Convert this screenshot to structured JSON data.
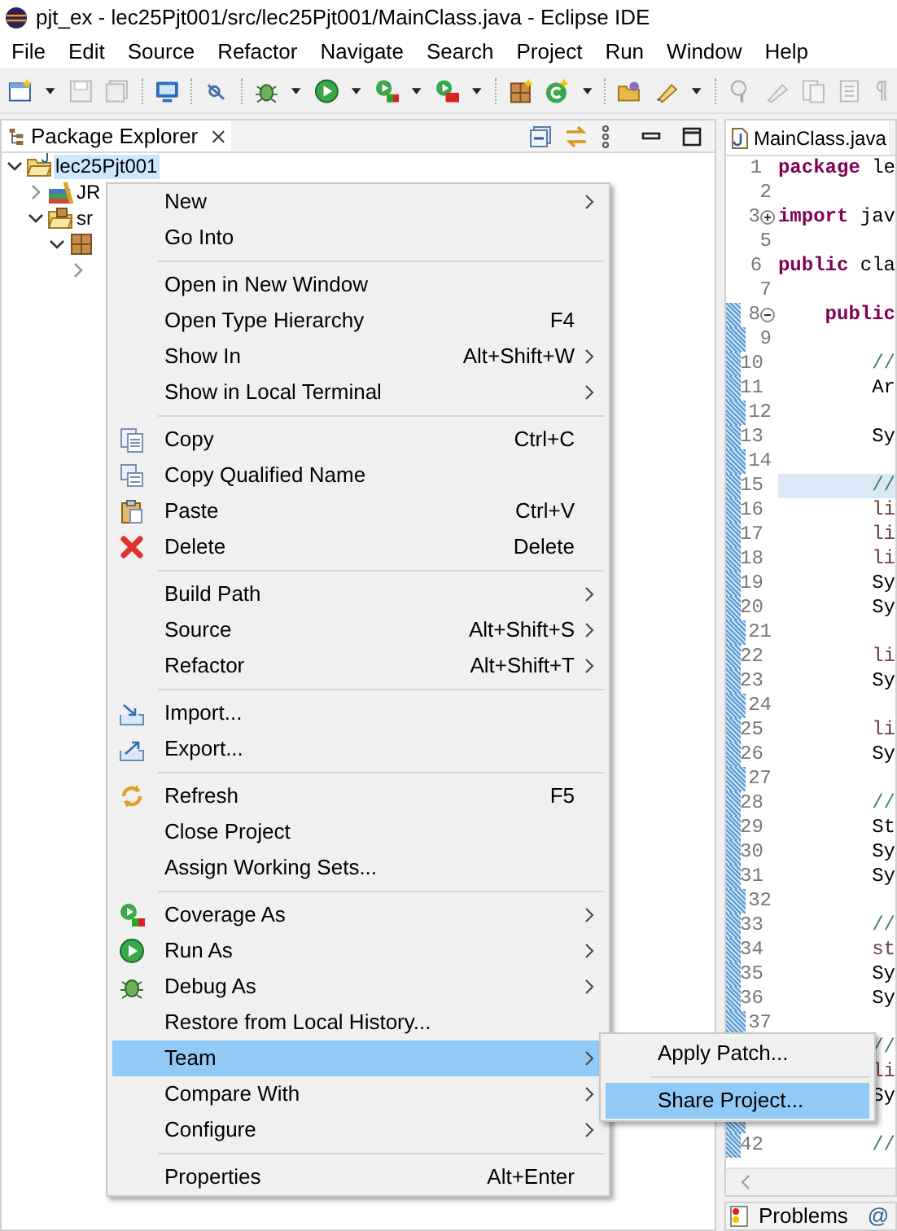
{
  "window": {
    "title": "pjt_ex - lec25Pjt001/src/lec25Pjt001/MainClass.java - Eclipse IDE"
  },
  "menu_bar": [
    "File",
    "Edit",
    "Source",
    "Refactor",
    "Navigate",
    "Search",
    "Project",
    "Run",
    "Window",
    "Help"
  ],
  "package_explorer": {
    "tab": "Package Explorer",
    "tree": [
      {
        "label": "lec25Pjt001",
        "selected": true,
        "expanded": true,
        "children": [
          {
            "label": "JR",
            "selected": false,
            "expanded": false
          },
          {
            "label": "sr",
            "selected": false,
            "expanded": true,
            "children": [
              {
                "expanded": true,
                "children": [
                  {
                    "expanded": false
                  }
                ]
              }
            ]
          }
        ]
      }
    ]
  },
  "editor": {
    "tab": "MainClass.java",
    "lines": [
      {
        "number": "1",
        "current": false,
        "changed": false,
        "code": [
          {
            "kind": "keyword",
            "text": "package"
          },
          {
            "kind": "plain",
            "text": " le"
          }
        ]
      },
      {
        "number": "2",
        "current": false,
        "changed": false
      },
      {
        "number": "3",
        "current": false,
        "changed": false,
        "folded": true,
        "code": [
          {
            "kind": "keyword",
            "text": "import"
          },
          {
            "kind": "plain",
            "text": " jav"
          }
        ]
      },
      {
        "number": "5",
        "current": false,
        "changed": false
      },
      {
        "number": "6",
        "current": false,
        "changed": false,
        "code": [
          {
            "kind": "keyword",
            "text": "public"
          },
          {
            "kind": "plain",
            "text": " cla"
          }
        ]
      },
      {
        "number": "7",
        "current": false,
        "changed": false
      },
      {
        "number": "8",
        "current": false,
        "changed": true,
        "folded": false,
        "code": [
          {
            "kind": "keyword",
            "text": "    public"
          }
        ]
      },
      {
        "number": "9",
        "current": false,
        "changed": true
      },
      {
        "number": "10",
        "current": false,
        "changed": true,
        "code": [
          {
            "kind": "comment",
            "text": "        //"
          }
        ]
      },
      {
        "number": "11",
        "current": false,
        "changed": true,
        "code": [
          {
            "kind": "plain",
            "text": "        Ar"
          }
        ]
      },
      {
        "number": "12",
        "current": false,
        "changed": true
      },
      {
        "number": "13",
        "current": false,
        "changed": true,
        "code": [
          {
            "kind": "plain",
            "text": "        Sy"
          }
        ]
      },
      {
        "number": "14",
        "current": false,
        "changed": true
      },
      {
        "number": "15",
        "current": true,
        "changed": true,
        "code": [
          {
            "kind": "comment",
            "text": "        //"
          }
        ]
      },
      {
        "number": "16",
        "current": false,
        "changed": true,
        "code": [
          {
            "kind": "variable",
            "text": "        li"
          }
        ]
      },
      {
        "number": "17",
        "current": false,
        "changed": true,
        "code": [
          {
            "kind": "variable",
            "text": "        li"
          }
        ]
      },
      {
        "number": "18",
        "current": false,
        "changed": true,
        "code": [
          {
            "kind": "variable",
            "text": "        li"
          }
        ]
      },
      {
        "number": "19",
        "current": false,
        "changed": true,
        "code": [
          {
            "kind": "plain",
            "text": "        Sy"
          }
        ]
      },
      {
        "number": "20",
        "current": false,
        "changed": true,
        "code": [
          {
            "kind": "plain",
            "text": "        Sy"
          }
        ]
      },
      {
        "number": "21",
        "current": false,
        "changed": true
      },
      {
        "number": "22",
        "current": false,
        "changed": true,
        "code": [
          {
            "kind": "variable",
            "text": "        li"
          }
        ]
      },
      {
        "number": "23",
        "current": false,
        "changed": true,
        "code": [
          {
            "kind": "plain",
            "text": "        Sy"
          }
        ]
      },
      {
        "number": "24",
        "current": false,
        "changed": true
      },
      {
        "number": "25",
        "current": false,
        "changed": true,
        "code": [
          {
            "kind": "variable",
            "text": "        li"
          }
        ]
      },
      {
        "number": "26",
        "current": false,
        "changed": true,
        "code": [
          {
            "kind": "plain",
            "text": "        Sy"
          }
        ]
      },
      {
        "number": "27",
        "current": false,
        "changed": true
      },
      {
        "number": "28",
        "current": false,
        "changed": true,
        "code": [
          {
            "kind": "comment",
            "text": "        //"
          }
        ]
      },
      {
        "number": "29",
        "current": false,
        "changed": true,
        "code": [
          {
            "kind": "plain",
            "text": "        St"
          }
        ]
      },
      {
        "number": "30",
        "current": false,
        "changed": true,
        "code": [
          {
            "kind": "plain",
            "text": "        Sy"
          }
        ]
      },
      {
        "number": "31",
        "current": false,
        "changed": true,
        "code": [
          {
            "kind": "plain",
            "text": "        Sy"
          }
        ]
      },
      {
        "number": "32",
        "current": false,
        "changed": true
      },
      {
        "number": "33",
        "current": false,
        "changed": true,
        "code": [
          {
            "kind": "comment",
            "text": "        //"
          }
        ]
      },
      {
        "number": "34",
        "current": false,
        "changed": true,
        "code": [
          {
            "kind": "variable",
            "text": "        st"
          }
        ]
      },
      {
        "number": "35",
        "current": false,
        "changed": true,
        "code": [
          {
            "kind": "plain",
            "text": "        Sy"
          }
        ]
      },
      {
        "number": "36",
        "current": false,
        "changed": true,
        "code": [
          {
            "kind": "plain",
            "text": "        Sy"
          }
        ]
      },
      {
        "number": "37",
        "current": false,
        "changed": true
      },
      {
        "current": false,
        "code": [
          {
            "kind": "comment",
            "text": "        //"
          }
        ]
      },
      {
        "current": false,
        "code": [
          {
            "kind": "variable",
            "text": "        li"
          }
        ]
      },
      {
        "current": false,
        "code": [
          {
            "kind": "plain",
            "text": "        Sy"
          }
        ]
      },
      {
        "current": false,
        "changed": true
      },
      {
        "number": "42",
        "current": false,
        "changed": true,
        "code": [
          {
            "kind": "comment",
            "text": "        //"
          }
        ]
      }
    ]
  },
  "bottom_panel": {
    "tabs": [
      "Problems",
      "@"
    ]
  },
  "context_menu": {
    "items": [
      {
        "kind": "item",
        "label": "New",
        "submenu": true,
        "selected": false
      },
      {
        "kind": "item",
        "label": "Go Into",
        "submenu": false,
        "selected": false
      },
      {
        "kind": "separator"
      },
      {
        "kind": "item",
        "label": "Open in New Window",
        "submenu": false,
        "selected": false
      },
      {
        "kind": "item",
        "label": "Open Type Hierarchy",
        "shortcut": "F4",
        "submenu": false,
        "selected": false
      },
      {
        "kind": "item",
        "label": "Show In",
        "shortcut": "Alt+Shift+W",
        "submenu": true,
        "selected": false
      },
      {
        "kind": "item",
        "label": "Show in Local Terminal",
        "submenu": true,
        "selected": false
      },
      {
        "kind": "separator"
      },
      {
        "kind": "item",
        "label": "Copy",
        "shortcut": "Ctrl+C",
        "submenu": false,
        "selected": false
      },
      {
        "kind": "item",
        "label": "Copy Qualified Name",
        "submenu": false,
        "selected": false
      },
      {
        "kind": "item",
        "label": "Paste",
        "shortcut": "Ctrl+V",
        "submenu": false,
        "selected": false
      },
      {
        "kind": "item",
        "label": "Delete",
        "shortcut": "Delete",
        "submenu": false,
        "selected": false
      },
      {
        "kind": "separator"
      },
      {
        "kind": "item",
        "label": "Build Path",
        "submenu": true,
        "selected": false
      },
      {
        "kind": "item",
        "label": "Source",
        "shortcut": "Alt+Shift+S",
        "submenu": true,
        "selected": false
      },
      {
        "kind": "item",
        "label": "Refactor",
        "shortcut": "Alt+Shift+T",
        "submenu": true,
        "selected": false
      },
      {
        "kind": "separator"
      },
      {
        "kind": "item",
        "label": "Import...",
        "submenu": false,
        "selected": false
      },
      {
        "kind": "item",
        "label": "Export...",
        "submenu": false,
        "selected": false
      },
      {
        "kind": "separator"
      },
      {
        "kind": "item",
        "label": "Refresh",
        "shortcut": "F5",
        "submenu": false,
        "selected": false
      },
      {
        "kind": "item",
        "label": "Close Project",
        "submenu": false,
        "selected": false
      },
      {
        "kind": "item",
        "label": "Assign Working Sets...",
        "submenu": false,
        "selected": false
      },
      {
        "kind": "separator"
      },
      {
        "kind": "item",
        "label": "Coverage As",
        "submenu": true,
        "selected": false
      },
      {
        "kind": "item",
        "label": "Run As",
        "submenu": true,
        "selected": false
      },
      {
        "kind": "item",
        "label": "Debug As",
        "submenu": true,
        "selected": false
      },
      {
        "kind": "item",
        "label": "Restore from Local History...",
        "submenu": false,
        "selected": false
      },
      {
        "kind": "item",
        "label": "Team",
        "submenu": true,
        "selected": true
      },
      {
        "kind": "item",
        "label": "Compare With",
        "submenu": true,
        "selected": false
      },
      {
        "kind": "item",
        "label": "Configure",
        "submenu": true,
        "selected": false
      },
      {
        "kind": "separator"
      },
      {
        "kind": "item",
        "label": "Properties",
        "shortcut": "Alt+Enter",
        "submenu": false,
        "selected": false
      }
    ]
  },
  "team_submenu": {
    "items": [
      {
        "kind": "item",
        "label": "Apply Patch...",
        "selected": false
      },
      {
        "kind": "separator"
      },
      {
        "kind": "item",
        "label": "Share Project...",
        "selected": true
      }
    ]
  }
}
